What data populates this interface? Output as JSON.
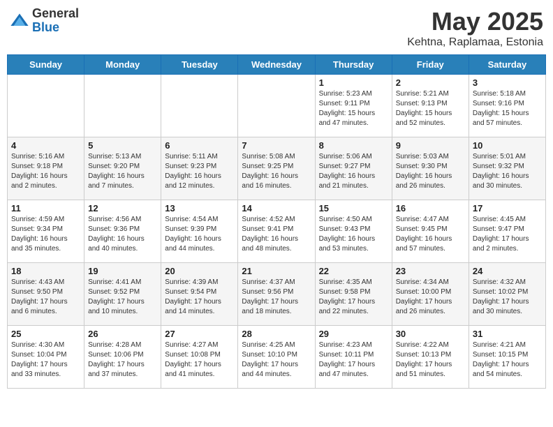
{
  "logo": {
    "general": "General",
    "blue": "Blue"
  },
  "title": "May 2025",
  "subtitle": "Kehtna, Raplamaa, Estonia",
  "days": [
    "Sunday",
    "Monday",
    "Tuesday",
    "Wednesday",
    "Thursday",
    "Friday",
    "Saturday"
  ],
  "weeks": [
    [
      {
        "date": "",
        "info": ""
      },
      {
        "date": "",
        "info": ""
      },
      {
        "date": "",
        "info": ""
      },
      {
        "date": "",
        "info": ""
      },
      {
        "date": "1",
        "info": "Sunrise: 5:23 AM\nSunset: 9:11 PM\nDaylight: 15 hours\nand 47 minutes."
      },
      {
        "date": "2",
        "info": "Sunrise: 5:21 AM\nSunset: 9:13 PM\nDaylight: 15 hours\nand 52 minutes."
      },
      {
        "date": "3",
        "info": "Sunrise: 5:18 AM\nSunset: 9:16 PM\nDaylight: 15 hours\nand 57 minutes."
      }
    ],
    [
      {
        "date": "4",
        "info": "Sunrise: 5:16 AM\nSunset: 9:18 PM\nDaylight: 16 hours\nand 2 minutes."
      },
      {
        "date": "5",
        "info": "Sunrise: 5:13 AM\nSunset: 9:20 PM\nDaylight: 16 hours\nand 7 minutes."
      },
      {
        "date": "6",
        "info": "Sunrise: 5:11 AM\nSunset: 9:23 PM\nDaylight: 16 hours\nand 12 minutes."
      },
      {
        "date": "7",
        "info": "Sunrise: 5:08 AM\nSunset: 9:25 PM\nDaylight: 16 hours\nand 16 minutes."
      },
      {
        "date": "8",
        "info": "Sunrise: 5:06 AM\nSunset: 9:27 PM\nDaylight: 16 hours\nand 21 minutes."
      },
      {
        "date": "9",
        "info": "Sunrise: 5:03 AM\nSunset: 9:30 PM\nDaylight: 16 hours\nand 26 minutes."
      },
      {
        "date": "10",
        "info": "Sunrise: 5:01 AM\nSunset: 9:32 PM\nDaylight: 16 hours\nand 30 minutes."
      }
    ],
    [
      {
        "date": "11",
        "info": "Sunrise: 4:59 AM\nSunset: 9:34 PM\nDaylight: 16 hours\nand 35 minutes."
      },
      {
        "date": "12",
        "info": "Sunrise: 4:56 AM\nSunset: 9:36 PM\nDaylight: 16 hours\nand 40 minutes."
      },
      {
        "date": "13",
        "info": "Sunrise: 4:54 AM\nSunset: 9:39 PM\nDaylight: 16 hours\nand 44 minutes."
      },
      {
        "date": "14",
        "info": "Sunrise: 4:52 AM\nSunset: 9:41 PM\nDaylight: 16 hours\nand 48 minutes."
      },
      {
        "date": "15",
        "info": "Sunrise: 4:50 AM\nSunset: 9:43 PM\nDaylight: 16 hours\nand 53 minutes."
      },
      {
        "date": "16",
        "info": "Sunrise: 4:47 AM\nSunset: 9:45 PM\nDaylight: 16 hours\nand 57 minutes."
      },
      {
        "date": "17",
        "info": "Sunrise: 4:45 AM\nSunset: 9:47 PM\nDaylight: 17 hours\nand 2 minutes."
      }
    ],
    [
      {
        "date": "18",
        "info": "Sunrise: 4:43 AM\nSunset: 9:50 PM\nDaylight: 17 hours\nand 6 minutes."
      },
      {
        "date": "19",
        "info": "Sunrise: 4:41 AM\nSunset: 9:52 PM\nDaylight: 17 hours\nand 10 minutes."
      },
      {
        "date": "20",
        "info": "Sunrise: 4:39 AM\nSunset: 9:54 PM\nDaylight: 17 hours\nand 14 minutes."
      },
      {
        "date": "21",
        "info": "Sunrise: 4:37 AM\nSunset: 9:56 PM\nDaylight: 17 hours\nand 18 minutes."
      },
      {
        "date": "22",
        "info": "Sunrise: 4:35 AM\nSunset: 9:58 PM\nDaylight: 17 hours\nand 22 minutes."
      },
      {
        "date": "23",
        "info": "Sunrise: 4:34 AM\nSunset: 10:00 PM\nDaylight: 17 hours\nand 26 minutes."
      },
      {
        "date": "24",
        "info": "Sunrise: 4:32 AM\nSunset: 10:02 PM\nDaylight: 17 hours\nand 30 minutes."
      }
    ],
    [
      {
        "date": "25",
        "info": "Sunrise: 4:30 AM\nSunset: 10:04 PM\nDaylight: 17 hours\nand 33 minutes."
      },
      {
        "date": "26",
        "info": "Sunrise: 4:28 AM\nSunset: 10:06 PM\nDaylight: 17 hours\nand 37 minutes."
      },
      {
        "date": "27",
        "info": "Sunrise: 4:27 AM\nSunset: 10:08 PM\nDaylight: 17 hours\nand 41 minutes."
      },
      {
        "date": "28",
        "info": "Sunrise: 4:25 AM\nSunset: 10:10 PM\nDaylight: 17 hours\nand 44 minutes."
      },
      {
        "date": "29",
        "info": "Sunrise: 4:23 AM\nSunset: 10:11 PM\nDaylight: 17 hours\nand 47 minutes."
      },
      {
        "date": "30",
        "info": "Sunrise: 4:22 AM\nSunset: 10:13 PM\nDaylight: 17 hours\nand 51 minutes."
      },
      {
        "date": "31",
        "info": "Sunrise: 4:21 AM\nSunset: 10:15 PM\nDaylight: 17 hours\nand 54 minutes."
      }
    ]
  ]
}
